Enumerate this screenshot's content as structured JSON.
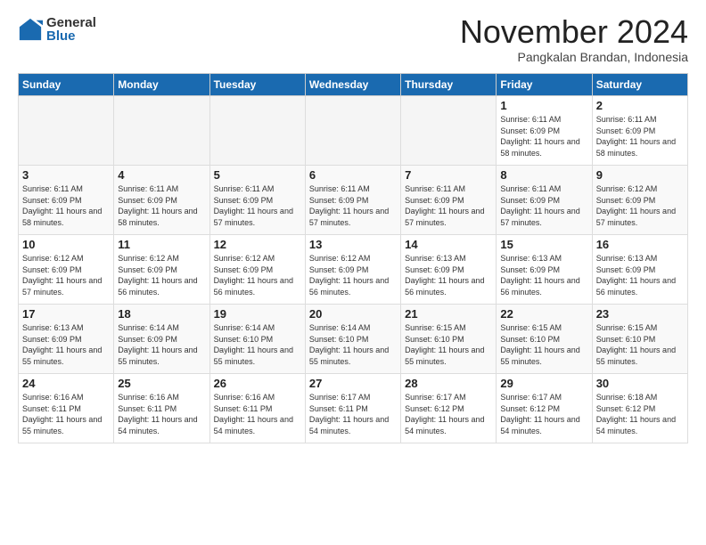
{
  "logo": {
    "general": "General",
    "blue": "Blue"
  },
  "title": "November 2024",
  "subtitle": "Pangkalan Brandan, Indonesia",
  "weekdays": [
    "Sunday",
    "Monday",
    "Tuesday",
    "Wednesday",
    "Thursday",
    "Friday",
    "Saturday"
  ],
  "weeks": [
    [
      {
        "day": "",
        "empty": true
      },
      {
        "day": "",
        "empty": true
      },
      {
        "day": "",
        "empty": true
      },
      {
        "day": "",
        "empty": true
      },
      {
        "day": "",
        "empty": true
      },
      {
        "day": "1",
        "sunrise": "6:11 AM",
        "sunset": "6:09 PM",
        "daylight": "11 hours and 58 minutes."
      },
      {
        "day": "2",
        "sunrise": "6:11 AM",
        "sunset": "6:09 PM",
        "daylight": "11 hours and 58 minutes."
      }
    ],
    [
      {
        "day": "3",
        "sunrise": "6:11 AM",
        "sunset": "6:09 PM",
        "daylight": "11 hours and 58 minutes."
      },
      {
        "day": "4",
        "sunrise": "6:11 AM",
        "sunset": "6:09 PM",
        "daylight": "11 hours and 58 minutes."
      },
      {
        "day": "5",
        "sunrise": "6:11 AM",
        "sunset": "6:09 PM",
        "daylight": "11 hours and 57 minutes."
      },
      {
        "day": "6",
        "sunrise": "6:11 AM",
        "sunset": "6:09 PM",
        "daylight": "11 hours and 57 minutes."
      },
      {
        "day": "7",
        "sunrise": "6:11 AM",
        "sunset": "6:09 PM",
        "daylight": "11 hours and 57 minutes."
      },
      {
        "day": "8",
        "sunrise": "6:11 AM",
        "sunset": "6:09 PM",
        "daylight": "11 hours and 57 minutes."
      },
      {
        "day": "9",
        "sunrise": "6:12 AM",
        "sunset": "6:09 PM",
        "daylight": "11 hours and 57 minutes."
      }
    ],
    [
      {
        "day": "10",
        "sunrise": "6:12 AM",
        "sunset": "6:09 PM",
        "daylight": "11 hours and 57 minutes."
      },
      {
        "day": "11",
        "sunrise": "6:12 AM",
        "sunset": "6:09 PM",
        "daylight": "11 hours and 56 minutes."
      },
      {
        "day": "12",
        "sunrise": "6:12 AM",
        "sunset": "6:09 PM",
        "daylight": "11 hours and 56 minutes."
      },
      {
        "day": "13",
        "sunrise": "6:12 AM",
        "sunset": "6:09 PM",
        "daylight": "11 hours and 56 minutes."
      },
      {
        "day": "14",
        "sunrise": "6:13 AM",
        "sunset": "6:09 PM",
        "daylight": "11 hours and 56 minutes."
      },
      {
        "day": "15",
        "sunrise": "6:13 AM",
        "sunset": "6:09 PM",
        "daylight": "11 hours and 56 minutes."
      },
      {
        "day": "16",
        "sunrise": "6:13 AM",
        "sunset": "6:09 PM",
        "daylight": "11 hours and 56 minutes."
      }
    ],
    [
      {
        "day": "17",
        "sunrise": "6:13 AM",
        "sunset": "6:09 PM",
        "daylight": "11 hours and 55 minutes."
      },
      {
        "day": "18",
        "sunrise": "6:14 AM",
        "sunset": "6:09 PM",
        "daylight": "11 hours and 55 minutes."
      },
      {
        "day": "19",
        "sunrise": "6:14 AM",
        "sunset": "6:10 PM",
        "daylight": "11 hours and 55 minutes."
      },
      {
        "day": "20",
        "sunrise": "6:14 AM",
        "sunset": "6:10 PM",
        "daylight": "11 hours and 55 minutes."
      },
      {
        "day": "21",
        "sunrise": "6:15 AM",
        "sunset": "6:10 PM",
        "daylight": "11 hours and 55 minutes."
      },
      {
        "day": "22",
        "sunrise": "6:15 AM",
        "sunset": "6:10 PM",
        "daylight": "11 hours and 55 minutes."
      },
      {
        "day": "23",
        "sunrise": "6:15 AM",
        "sunset": "6:10 PM",
        "daylight": "11 hours and 55 minutes."
      }
    ],
    [
      {
        "day": "24",
        "sunrise": "6:16 AM",
        "sunset": "6:11 PM",
        "daylight": "11 hours and 55 minutes."
      },
      {
        "day": "25",
        "sunrise": "6:16 AM",
        "sunset": "6:11 PM",
        "daylight": "11 hours and 54 minutes."
      },
      {
        "day": "26",
        "sunrise": "6:16 AM",
        "sunset": "6:11 PM",
        "daylight": "11 hours and 54 minutes."
      },
      {
        "day": "27",
        "sunrise": "6:17 AM",
        "sunset": "6:11 PM",
        "daylight": "11 hours and 54 minutes."
      },
      {
        "day": "28",
        "sunrise": "6:17 AM",
        "sunset": "6:12 PM",
        "daylight": "11 hours and 54 minutes."
      },
      {
        "day": "29",
        "sunrise": "6:17 AM",
        "sunset": "6:12 PM",
        "daylight": "11 hours and 54 minutes."
      },
      {
        "day": "30",
        "sunrise": "6:18 AM",
        "sunset": "6:12 PM",
        "daylight": "11 hours and 54 minutes."
      }
    ]
  ]
}
